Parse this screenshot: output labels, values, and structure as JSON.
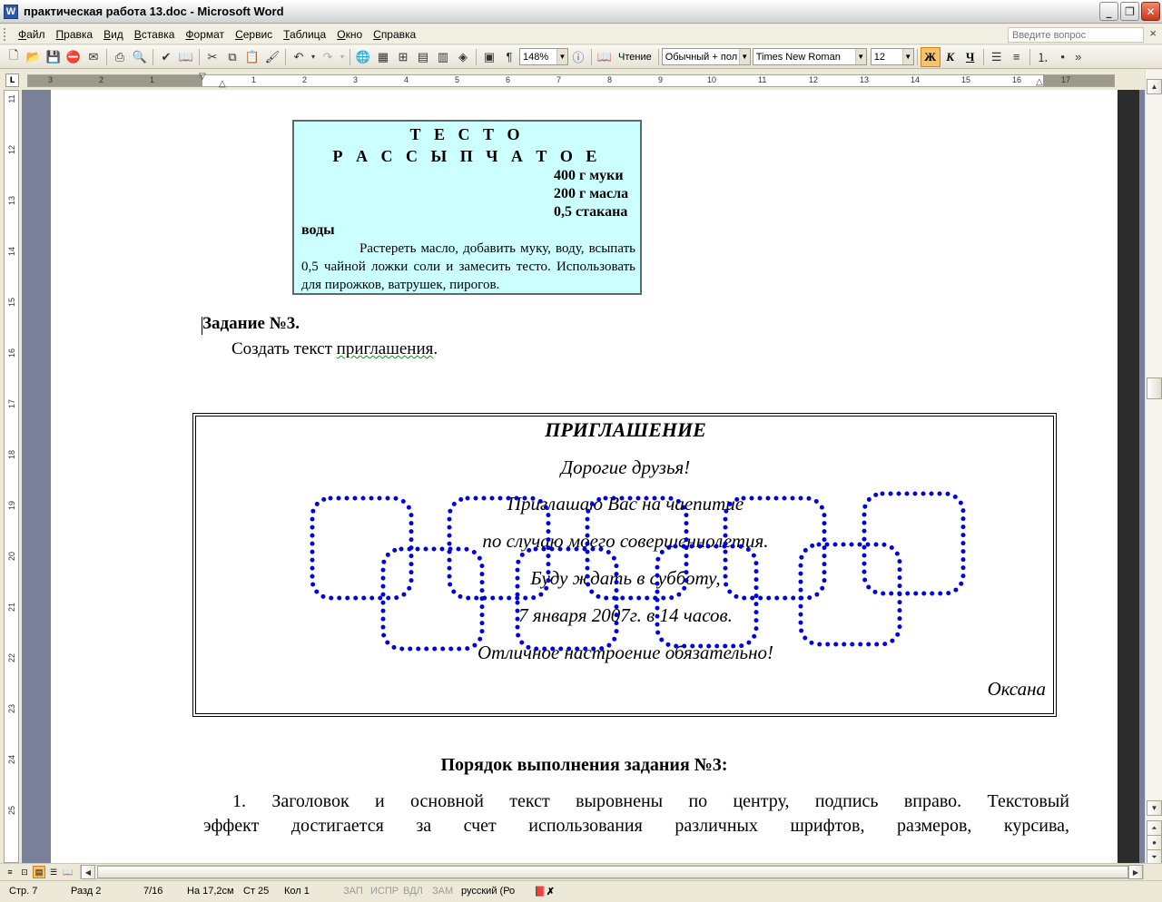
{
  "window": {
    "title": "практическая работа 13.doc - Microsoft Word",
    "app_icon": "W"
  },
  "menu": {
    "items": [
      "Файл",
      "Правка",
      "Вид",
      "Вставка",
      "Формат",
      "Сервис",
      "Таблица",
      "Окно",
      "Справка"
    ],
    "help_placeholder": "Введите вопрос"
  },
  "toolbar": {
    "zoom": "148%",
    "reading_label": "Чтение",
    "style": "Обычный + пол",
    "font": "Times New Roman",
    "size": "12",
    "bold_label": "Ж",
    "italic_label": "К",
    "underline_label": "Ч"
  },
  "ruler": {
    "h_labels": [
      "3",
      "2",
      "1",
      "1",
      "2",
      "3",
      "4",
      "5",
      "6",
      "7",
      "8",
      "9",
      "10",
      "11",
      "12",
      "13",
      "14",
      "15",
      "16",
      "17"
    ],
    "v_labels": [
      "11",
      "12",
      "13",
      "14",
      "15",
      "16",
      "17",
      "18",
      "19",
      "20",
      "21",
      "22",
      "23",
      "24",
      "25"
    ]
  },
  "recipe": {
    "title_line1": "Т Е С Т О",
    "title_line2": "Р А С С Ы П Ч А Т О Е",
    "ing1": "400 г муки",
    "ing2": "200 г масла",
    "ing3": "0,5  стакана",
    "ing3_cont": "воды",
    "text": "Растереть масло, добавить муку, воду, всыпать 0,5 чайной ложки соли и замесить тесто. Использовать для пирожков, ватрушек, пирогов."
  },
  "task": {
    "heading": "Задание №3.",
    "text_a": "Создать текст ",
    "text_b": "приглашения",
    "text_c": "."
  },
  "invitation": {
    "title": "ПРИГЛАШЕНИЕ",
    "line1": "Дорогие друзья!",
    "line2": "Приглашаю Вас на чаепитие",
    "line3": "по случаю моего совершеннолетия.",
    "line4": "Буду ждать в субботу,",
    "line5": "7 января 2007г. в 14 часов.",
    "line6": "Отличное настроение обязательно!",
    "signature": "Оксана",
    "chain_color": "#0000e0"
  },
  "order": {
    "heading": "Порядок выполнения задания №3:",
    "line1": "1. Заголовок  и  основной  текст  выровнены  по  центру,  подпись  вправо.  Текстовый",
    "line2": "эффект  достигается  за  счет  использования  различных  шрифтов,  размеров,  курсива,"
  },
  "status": {
    "page": "Стр. 7",
    "section": "Разд 2",
    "pages": "7/16",
    "at": "На 17,2см",
    "line": "Ст 25",
    "col": "Кол 1",
    "rec": "ЗАП",
    "trk": "ИСПР",
    "ext": "ВДЛ",
    "ovr": "ЗАМ",
    "lang": "русский (Ро"
  }
}
